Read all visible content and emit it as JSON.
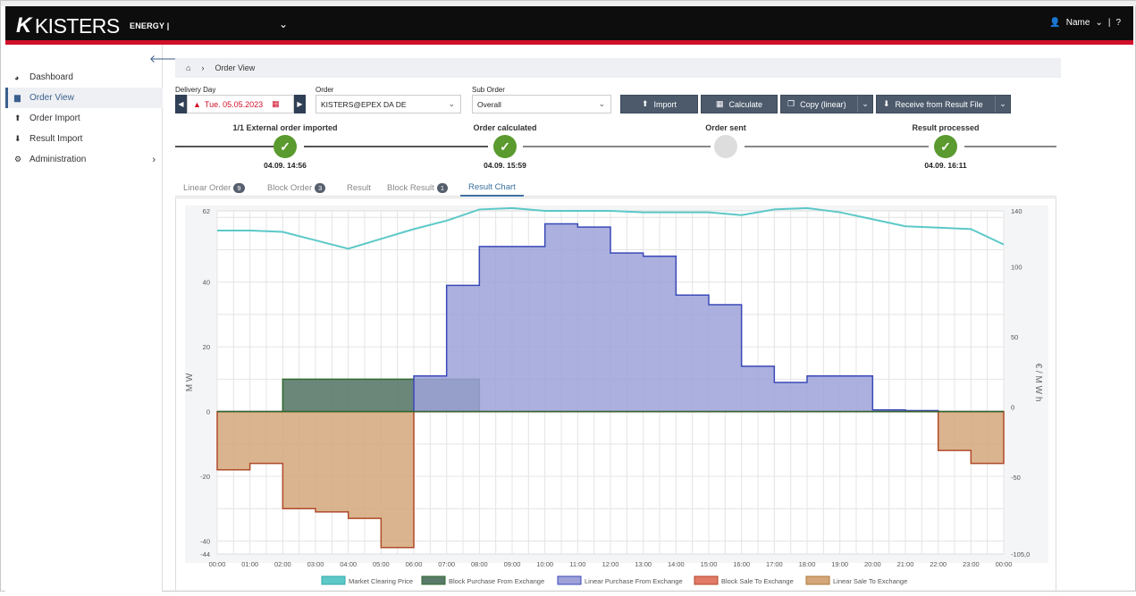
{
  "header": {
    "brand": "KISTERS",
    "product": "ENERGY |",
    "user": "Name"
  },
  "sidebar": {
    "items": [
      {
        "label": "Dashboard",
        "icon": "dashboard-icon"
      },
      {
        "label": "Order View",
        "icon": "cart-icon"
      },
      {
        "label": "Order Import",
        "icon": "upload-icon"
      },
      {
        "label": "Result Import",
        "icon": "download-icon"
      },
      {
        "label": "Administration",
        "icon": "cogs-icon"
      }
    ]
  },
  "breadcrumb": {
    "current": "Order View"
  },
  "filters": {
    "delivery_day_label": "Delivery Day",
    "delivery_day_value": "Tue. 05.05.2023",
    "order_label": "Order",
    "order_value": "KISTERS@EPEX DA DE",
    "sub_order_label": "Sub Order",
    "sub_order_value": "Overall"
  },
  "buttons": {
    "import": "Import",
    "calculate": "Calculate",
    "copy": "Copy (linear)",
    "receive": "Receive from Result File"
  },
  "steps": [
    {
      "title": "1/1 External order imported",
      "time": "04.09. 14:56",
      "done": true
    },
    {
      "title": "Order calculated",
      "time": "04.09. 15:59",
      "done": true
    },
    {
      "title": "Order sent",
      "time": "",
      "done": false
    },
    {
      "title": "Result processed",
      "time": "04.09. 16:11",
      "done": true
    }
  ],
  "tabs": [
    {
      "label": "Linear Order",
      "badge": "9"
    },
    {
      "label": "Block Order",
      "badge": "3"
    },
    {
      "label": "Result",
      "badge": ""
    },
    {
      "label": "Block Result",
      "badge": "1"
    },
    {
      "label": "Result Chart",
      "badge": ""
    }
  ],
  "colors": {
    "topbar": "#0d0d0d",
    "accent_red": "#d0102a",
    "button": "#4c5a6c",
    "step_done": "#5a9a2e",
    "step_pending": "#dddddd"
  },
  "chart_data": {
    "type": "area",
    "ylabel": "M W",
    "y2label": "€ / M W h",
    "ylim": [
      -44,
      62
    ],
    "y2lim": [
      -105,
      140
    ],
    "y_ticks": [
      "62",
      "40",
      "20",
      "0",
      "-20",
      "-40",
      "-44"
    ],
    "y2_ticks": [
      "140",
      "100",
      "50",
      "0",
      "-50",
      "-105,0"
    ],
    "x": [
      "00:00",
      "01:00",
      "02:00",
      "03:00",
      "04:00",
      "05:00",
      "06:00",
      "07:00",
      "08:00",
      "09:00",
      "10:00",
      "11:00",
      "12:00",
      "13:00",
      "14:00",
      "15:00",
      "16:00",
      "17:00",
      "18:00",
      "19:00",
      "20:00",
      "21:00",
      "22:00",
      "23:00",
      "00:00"
    ],
    "series": [
      {
        "name": "Market Clearing Price",
        "kind": "line",
        "axis": "right",
        "color": "#5cc8c8",
        "values": [
          126,
          126,
          125,
          119,
          113,
          120,
          127,
          133,
          141,
          142,
          140,
          140,
          140,
          139,
          139,
          139,
          137,
          141,
          142,
          139,
          134,
          129,
          128,
          127,
          116
        ]
      },
      {
        "name": "Block Purchase From Exchange",
        "kind": "step",
        "axis": "left",
        "color": "#5a7a6a",
        "values": [
          0,
          0,
          10,
          10,
          10,
          10,
          10,
          10,
          0,
          0,
          0,
          0,
          0,
          0,
          0,
          0,
          0,
          0,
          0,
          0,
          0,
          0,
          0,
          0
        ]
      },
      {
        "name": "Linear Purchase From Exchange",
        "kind": "step",
        "axis": "left",
        "color": "#9ea2d8",
        "values": [
          0,
          0,
          0,
          0,
          0,
          0,
          11,
          39,
          51,
          51,
          58,
          57,
          49,
          48,
          36,
          33,
          14,
          9,
          11,
          11,
          0.5,
          0.3,
          0,
          0
        ]
      },
      {
        "name": "Block Sale To Exchange",
        "kind": "step",
        "axis": "left",
        "color": "#e27a68",
        "values": [
          0,
          0,
          0,
          0,
          0,
          0,
          0,
          0,
          0,
          0,
          0,
          0,
          0,
          0,
          0,
          0,
          0,
          0,
          0,
          0,
          0,
          0,
          0,
          0
        ]
      },
      {
        "name": "Linear Sale To Exchange",
        "kind": "step",
        "axis": "left",
        "color": "#d4a77a",
        "values": [
          -18,
          -16,
          -30,
          -31,
          -33,
          -42,
          0,
          0,
          0,
          0,
          0,
          0,
          0,
          0,
          0,
          0,
          0,
          0,
          0,
          0,
          0,
          0,
          -12,
          -16
        ]
      }
    ],
    "grid": true,
    "legend": "bottom"
  }
}
